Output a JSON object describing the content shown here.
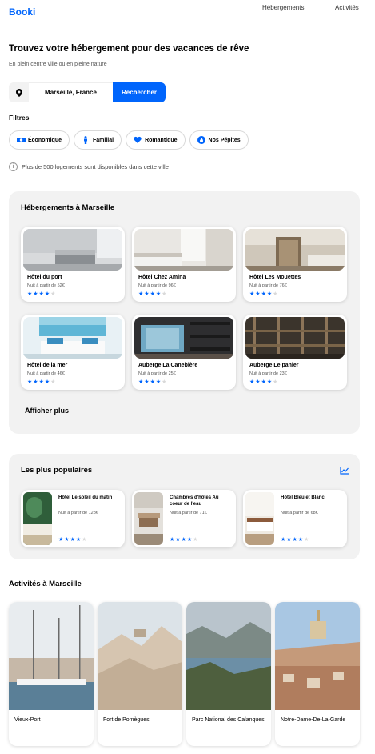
{
  "header": {
    "logo": "Booki",
    "nav": [
      "Hébergements",
      "Activités"
    ]
  },
  "hero": {
    "title": "Trouvez votre hébergement pour des vacances de rêve",
    "subtitle": "En plein centre ville ou en pleine nature"
  },
  "search": {
    "location": "Marseille, France",
    "button": "Rechercher"
  },
  "filters": {
    "title": "Filtres",
    "chips": [
      {
        "label": "Économique",
        "icon": "money-icon"
      },
      {
        "label": "Familial",
        "icon": "child-icon"
      },
      {
        "label": "Romantique",
        "icon": "heart-icon"
      },
      {
        "label": "Nos Pépites",
        "icon": "fire-icon"
      }
    ]
  },
  "info": {
    "text": "Plus de 500 logements sont disponibles dans cette ville"
  },
  "hebergements": {
    "title": "Hébergements à Marseille",
    "more": "Afficher plus",
    "items": [
      {
        "name": "Hôtel du port",
        "price": "Nuit à partir de 52€",
        "rating": 4
      },
      {
        "name": "Hôtel Chez Amina",
        "price": "Nuit à partir de 96€",
        "rating": 4
      },
      {
        "name": "Hôtel Les Mouettes",
        "price": "Nuit à partir de 76€",
        "rating": 4
      },
      {
        "name": "Hôtel de la mer",
        "price": "Nuit à partir de 46€",
        "rating": 4
      },
      {
        "name": "Auberge La Canebière",
        "price": "Nuit à partir de 25€",
        "rating": 4
      },
      {
        "name": "Auberge Le panier",
        "price": "Nuit à partir de 23€",
        "rating": 4
      }
    ]
  },
  "populaires": {
    "title": "Les plus populaires",
    "icon": "trend-chart-icon",
    "items": [
      {
        "name": "Hôtel Le soleil du matin",
        "price": "Nuit à partir de 128€",
        "rating": 4
      },
      {
        "name": "Chambres d'hôtes Au coeur de l'eau",
        "price": "Nuit à partir de 71€",
        "rating": 4
      },
      {
        "name": "Hôtel Bleu et Blanc",
        "price": "Nuit à partir de 68€",
        "rating": 4
      }
    ]
  },
  "activites": {
    "title": "Activités à Marseille",
    "items": [
      {
        "name": "Vieux-Port"
      },
      {
        "name": "Fort de Pomègues"
      },
      {
        "name": "Parc National des Calanques"
      },
      {
        "name": "Notre-Dame-De-La-Garde"
      }
    ]
  },
  "colors": {
    "primary": "#0065FC",
    "panel": "#F2F2F2",
    "star_off": "#D9D9D9"
  }
}
